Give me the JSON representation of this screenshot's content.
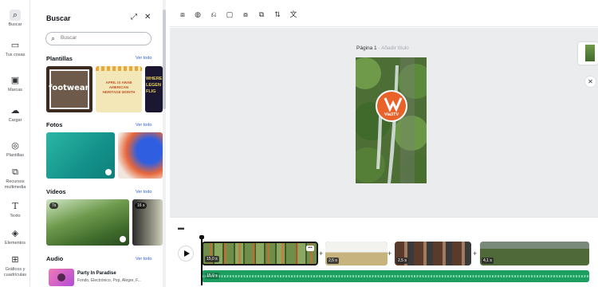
{
  "rail": {
    "items": [
      {
        "label": "Buscar",
        "icon": "search-icon"
      },
      {
        "label": "Tus cosas",
        "icon": "folder-icon"
      },
      {
        "label": "Marcas",
        "icon": "brand-icon"
      },
      {
        "label": "Cargar",
        "icon": "upload-icon"
      },
      {
        "label": "Plantillas",
        "icon": "templates-icon"
      },
      {
        "label": "Recursos multimedia",
        "icon": "media-icon"
      },
      {
        "label": "Texto",
        "icon": "text-icon"
      },
      {
        "label": "Elementos",
        "icon": "elements-icon"
      },
      {
        "label": "Gráficos y cuadrículas",
        "icon": "grids-icon"
      }
    ]
  },
  "panel": {
    "title": "Buscar",
    "search_placeholder": "Buscar",
    "sections": {
      "templates": {
        "title": "Plantillas",
        "see_all": "Ver todo"
      },
      "photos": {
        "title": "Fotos",
        "see_all": "Ver todo"
      },
      "videos": {
        "title": "Vídeos",
        "see_all": "Ver todo"
      },
      "audio": {
        "title": "Audio",
        "see_all": "Ver todo"
      }
    },
    "template_texts": {
      "footwear": "footwear",
      "april": "APRIL IS ARAB AMERICAN HERITAGE MONTH",
      "legend": "WHERE LEGEN FLIG"
    },
    "video_badges": [
      "7s",
      "16 s"
    ],
    "audio_track": {
      "title": "Party In Paradise",
      "subtitle": "Fondo, Electrónico, Pop, Alegre, F..."
    }
  },
  "canvas": {
    "page_label": "Página 1",
    "page_title_placeholder": " - Añadir título",
    "logo_text": "Via3TV"
  },
  "timeline": {
    "clip_durations": [
      "15,0 s",
      "2,5 s",
      "2,5 s",
      "4,1 s"
    ],
    "audio_duration": "15,0 s"
  },
  "colors": {
    "accent": "#2f5fd3",
    "audio_track": "#1d9e61",
    "logo": "#e8622a"
  }
}
